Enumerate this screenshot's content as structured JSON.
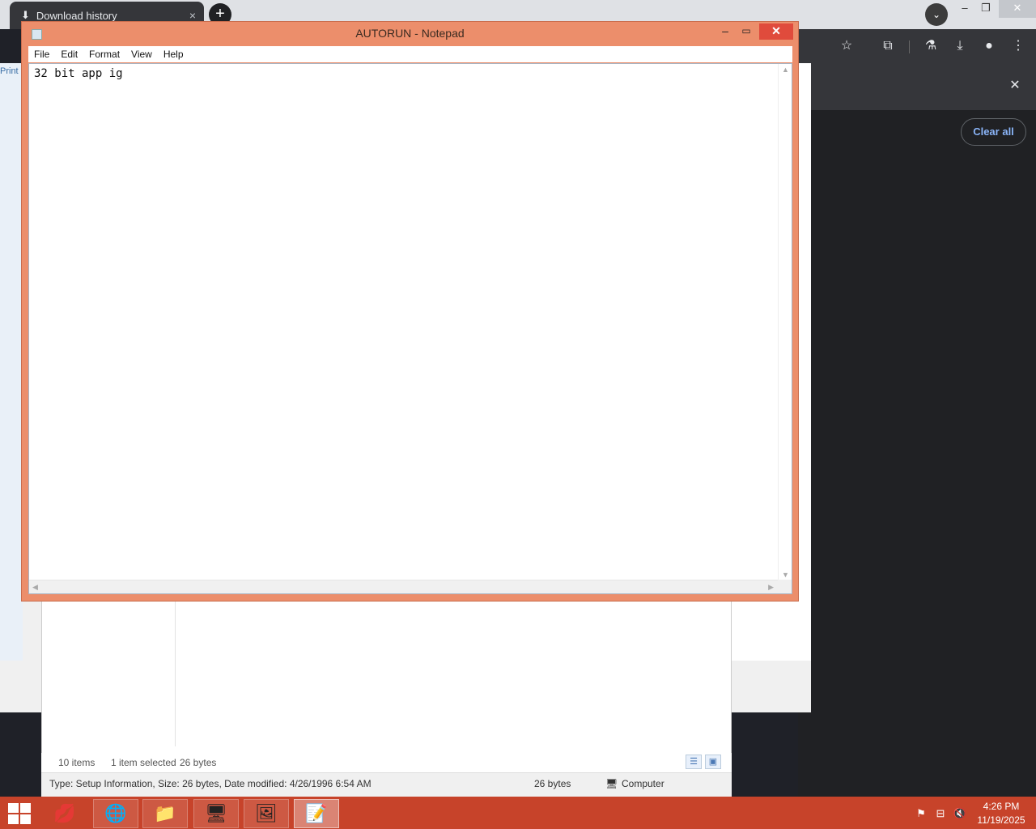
{
  "browser": {
    "tab_title": "Download history",
    "tab_close": "×",
    "new_tab": "+",
    "dropdown": "⌄",
    "min": "–",
    "restore": "❐",
    "close": "✕",
    "panel_close": "✕",
    "clear_all": "Clear all"
  },
  "explorer": {
    "print_label": "Print",
    "items_count": "10 items",
    "selected_info": "1 item selected",
    "selected_size": "26 bytes",
    "details": "Type: Setup Information, Size: 26 bytes, Date modified: 4/26/1996 6:54 AM",
    "details_size": "26 bytes",
    "details_location": "Computer"
  },
  "notepad": {
    "title": "AUTORUN - Notepad",
    "menu": [
      "File",
      "Edit",
      "Format",
      "View",
      "Help"
    ],
    "content": "32 bit app ig"
  },
  "taskbar": {
    "time": "4:26 PM",
    "date": "11/19/2025"
  },
  "colors": {
    "notepad_frame": "#ec8e6b",
    "taskbar": "#c7432a",
    "close_button": "#e04b3c",
    "chrome_dark": "#202124",
    "chrome_accent": "#8ab4f8"
  }
}
